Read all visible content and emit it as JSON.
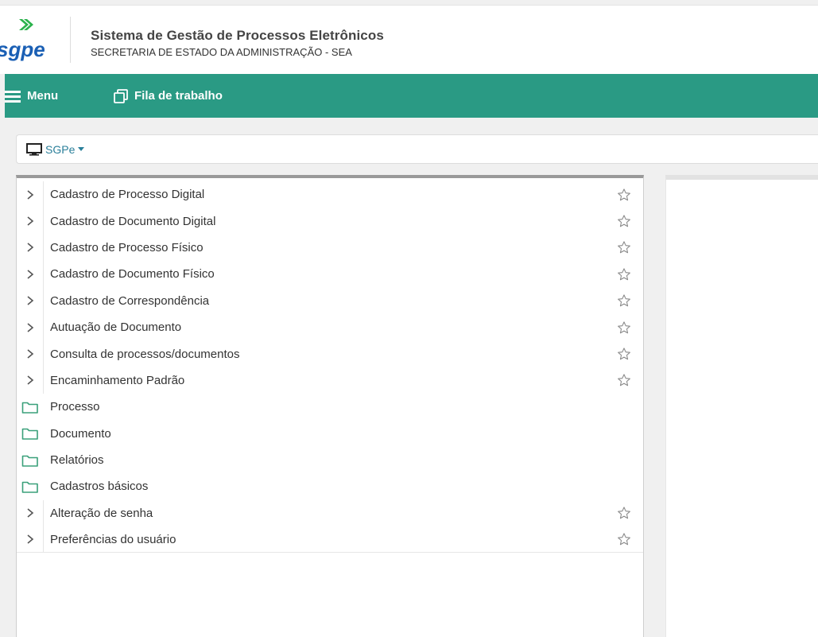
{
  "header": {
    "logo_text": "sgpe",
    "title": "Sistema de Gestão de Processos Eletrônicos",
    "subtitle": "SECRETARIA DE ESTADO DA ADMINISTRAÇÃO - SEA"
  },
  "navbar": {
    "menu_label": "Menu",
    "fila_label": "Fila de trabalho"
  },
  "module_selector": {
    "label": "SGPe"
  },
  "colors": {
    "navbar_bg": "#2a9a84",
    "logo_green": "#2bb24c",
    "logo_blue": "#1a5fb4",
    "link_blue": "#2a7f9a",
    "folder_green": "#3aa07a"
  },
  "menu": {
    "items": [
      {
        "label": "Cadastro de Processo Digital",
        "icon": "chevron-right-icon",
        "favorite": true
      },
      {
        "label": "Cadastro de Documento Digital",
        "icon": "chevron-right-icon",
        "favorite": true
      },
      {
        "label": "Cadastro de Processo Físico",
        "icon": "chevron-right-icon",
        "favorite": true
      },
      {
        "label": "Cadastro de Documento Físico",
        "icon": "chevron-right-icon",
        "favorite": true
      },
      {
        "label": "Cadastro de Correspondência",
        "icon": "chevron-right-icon",
        "favorite": true
      },
      {
        "label": "Autuação de Documento",
        "icon": "chevron-right-icon",
        "favorite": true
      },
      {
        "label": "Consulta de processos/documentos",
        "icon": "chevron-right-icon",
        "favorite": true
      },
      {
        "label": "Encaminhamento Padrão",
        "icon": "chevron-right-icon",
        "favorite": true
      },
      {
        "label": "Processo",
        "icon": "folder-icon",
        "favorite": false
      },
      {
        "label": "Documento",
        "icon": "folder-icon",
        "favorite": false
      },
      {
        "label": "Relatórios",
        "icon": "folder-icon",
        "favorite": false
      },
      {
        "label": "Cadastros básicos",
        "icon": "folder-icon",
        "favorite": false
      },
      {
        "label": "Alteração de senha",
        "icon": "chevron-right-icon",
        "favorite": true
      },
      {
        "label": "Preferências do usuário",
        "icon": "chevron-right-icon",
        "favorite": true
      }
    ]
  }
}
